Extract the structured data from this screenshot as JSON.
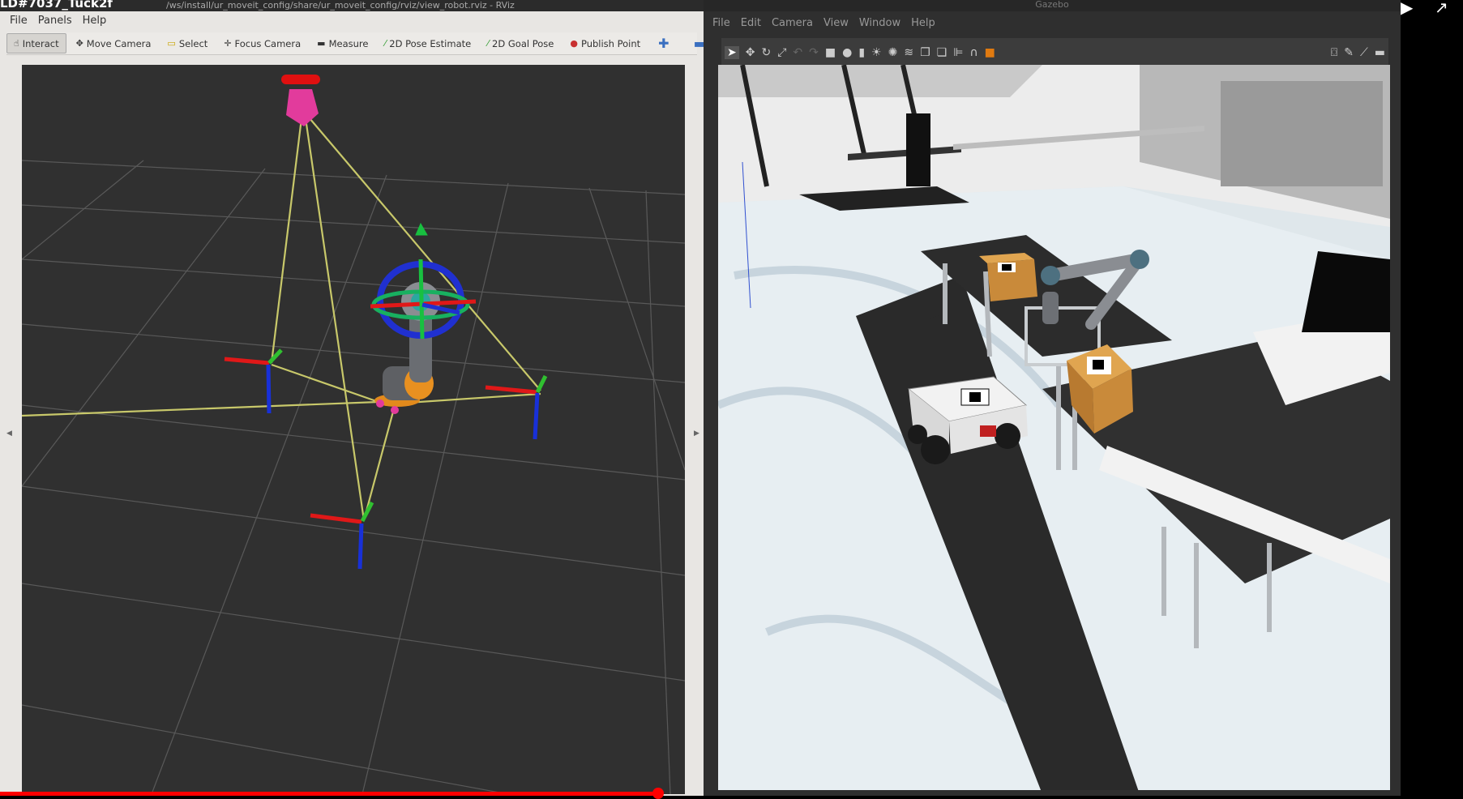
{
  "rviz": {
    "title_overlay": "LD#7037_Tuck2f",
    "title_path": "/ws/install/ur_moveit_config/share/ur_moveit_config/rviz/view_robot.rviz - RViz",
    "menu": [
      "File",
      "Panels",
      "Help"
    ],
    "tools": [
      {
        "label": "Interact",
        "icon": "interact-icon",
        "active": true
      },
      {
        "label": "Move Camera",
        "icon": "move-camera-icon",
        "active": false
      },
      {
        "label": "Select",
        "icon": "select-icon",
        "active": false
      },
      {
        "label": "Focus Camera",
        "icon": "focus-camera-icon",
        "active": false
      },
      {
        "label": "Measure",
        "icon": "measure-icon",
        "active": false
      },
      {
        "label": "2D Pose Estimate",
        "icon": "pose-estimate-icon",
        "active": false
      },
      {
        "label": "2D Goal Pose",
        "icon": "goal-pose-icon",
        "active": false
      },
      {
        "label": "Publish Point",
        "icon": "publish-point-icon",
        "active": false
      }
    ],
    "add_tool_icon": "plus-icon",
    "remove_tool_icon": "minus-icon"
  },
  "gazebo": {
    "title": "Gazebo",
    "menu": [
      "File",
      "Edit",
      "Camera",
      "View",
      "Window",
      "Help"
    ],
    "toolbar_icons": [
      "select-arrow-icon",
      "translate-icon",
      "rotate-icon",
      "scale-icon",
      "undo-icon",
      "redo-icon",
      "box-icon",
      "sphere-icon",
      "cylinder-icon",
      "point-light-icon",
      "spot-light-icon",
      "directional-light-icon",
      "copy-icon",
      "paste-icon",
      "align-icon",
      "snap-icon",
      "orange-box-icon",
      "camera-screenshot-icon",
      "log-icon",
      "plot-icon",
      "video-icon"
    ]
  },
  "player": {
    "progress": 0.45
  },
  "colors": {
    "rviz_bg": "#303030",
    "gazebo_floor": "#dfe7eb",
    "progress": "#ff0000"
  }
}
